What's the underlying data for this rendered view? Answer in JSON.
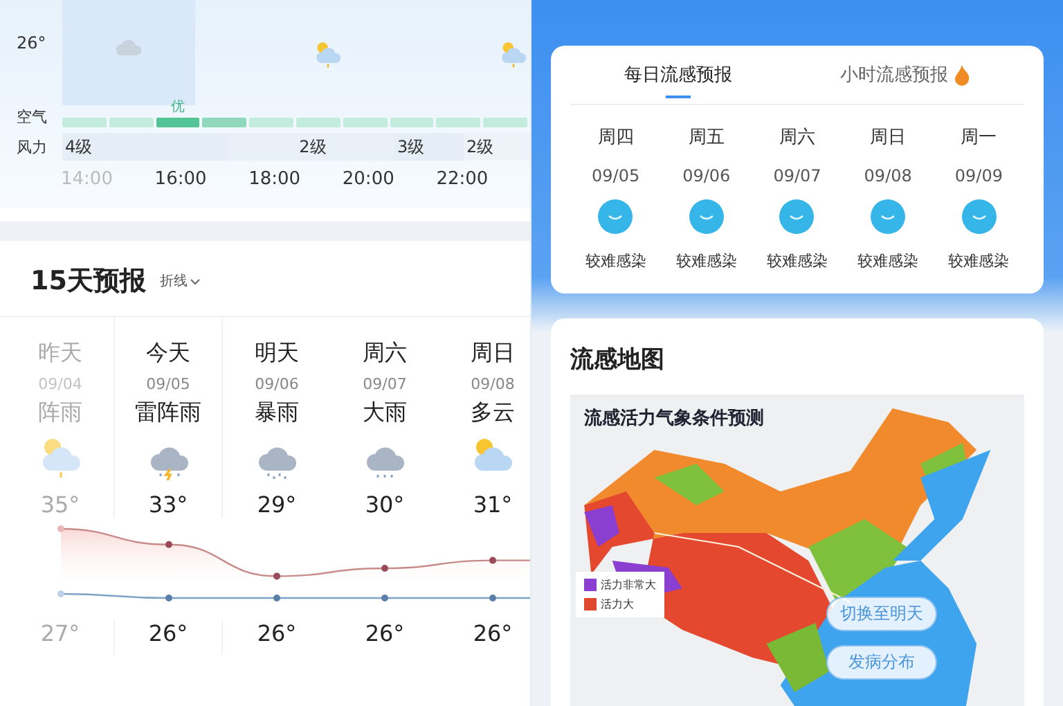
{
  "hourly": {
    "temperature": "26°",
    "slots": [
      {
        "kind": "cloud",
        "past": true
      },
      {
        "kind": "none",
        "past": false
      },
      {
        "kind": "sun-cloud-rain",
        "past": false
      },
      {
        "kind": "none",
        "past": false
      },
      {
        "kind": "none",
        "past": false
      },
      {
        "kind": "sun-cloud-rain",
        "past": false
      }
    ],
    "air": {
      "label": "空气",
      "segments": [
        {
          "color": "#c3ecdc"
        },
        {
          "color": "#c3ecdc"
        },
        {
          "color": "#52c496",
          "label": "优"
        },
        {
          "color": "#8fd8bb"
        },
        {
          "color": "#c3ecdc"
        },
        {
          "color": "#c3ecdc"
        },
        {
          "color": "#c3ecdc"
        },
        {
          "color": "#c3ecdc"
        },
        {
          "color": "#c3ecdc"
        },
        {
          "color": "#c3ecdc"
        }
      ]
    },
    "wind": {
      "label": "风力",
      "levels": [
        "4级",
        "2级",
        "3级",
        "2级"
      ]
    },
    "times": [
      {
        "text": "14:00",
        "past": true
      },
      {
        "text": "16:00",
        "past": false
      },
      {
        "text": "18:00",
        "past": false
      },
      {
        "text": "20:00",
        "past": false
      },
      {
        "text": "22:00",
        "past": false
      }
    ]
  },
  "forecast": {
    "title": "15天预报",
    "view": "折线",
    "days": [
      {
        "name": "昨天",
        "date": "09/04",
        "weather": "阵雨",
        "kind": "sun-cloud-rain",
        "high": "35°",
        "low": "27°",
        "past": true
      },
      {
        "name": "今天",
        "date": "09/05",
        "weather": "雷阵雨",
        "kind": "thunderstorm",
        "high": "33°",
        "low": "26°",
        "past": false
      },
      {
        "name": "明天",
        "date": "09/06",
        "weather": "暴雨",
        "kind": "heavy-rain",
        "high": "29°",
        "low": "26°",
        "past": false
      },
      {
        "name": "周六",
        "date": "09/07",
        "weather": "大雨",
        "kind": "rain",
        "high": "30°",
        "low": "26°",
        "past": false
      },
      {
        "name": "周日",
        "date": "09/08",
        "weather": "多云",
        "kind": "partly-cloudy",
        "high": "31°",
        "low": "26°",
        "past": false
      }
    ]
  },
  "flu": {
    "tabs": [
      {
        "label": "每日流感预报",
        "selected": true,
        "hot": false
      },
      {
        "label": "小时流感预报",
        "selected": false,
        "hot": true
      }
    ],
    "days": [
      {
        "name": "周四",
        "date": "09/05",
        "risk": "较难感染"
      },
      {
        "name": "周五",
        "date": "09/06",
        "risk": "较难感染"
      },
      {
        "name": "周六",
        "date": "09/07",
        "risk": "较难感染"
      },
      {
        "name": "周日",
        "date": "09/08",
        "risk": "较难感染"
      },
      {
        "name": "周一",
        "date": "09/09",
        "risk": "较难感染"
      }
    ]
  },
  "flu_map": {
    "title": "流感地图",
    "map_title": "流感活力气象条件预测",
    "legend": [
      {
        "label": "活力非常大",
        "color": "#8a3fd0"
      },
      {
        "label": "活力大",
        "color": "#e0472f"
      }
    ],
    "buttons": [
      "切换至明天",
      "发病分布"
    ]
  }
}
